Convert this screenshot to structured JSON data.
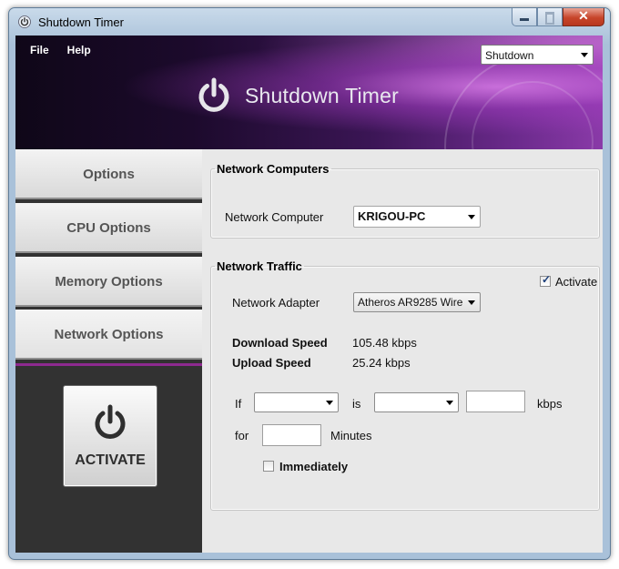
{
  "window": {
    "title": "Shutdown Timer",
    "buttons": {
      "minimize": "minimize",
      "maximize": "maximize",
      "close": "✕"
    }
  },
  "banner": {
    "menu": [
      "File",
      "Help"
    ],
    "mode_select": {
      "value": "Shutdown"
    },
    "logo_text": "Shutdown Timer"
  },
  "sidebar": {
    "items": [
      {
        "label": "Options"
      },
      {
        "label": "CPU Options"
      },
      {
        "label": "Memory Options"
      },
      {
        "label": "Network Options",
        "active": true
      }
    ],
    "activate_label": "ACTIVATE"
  },
  "network_computers": {
    "title": "Network Computers",
    "computer_label": "Network Computer",
    "computer_value": "KRIGOU-PC"
  },
  "network_traffic": {
    "title": "Network Traffic",
    "activate_label": "Activate",
    "activate_checked": true,
    "adapter_label": "Network Adapter",
    "adapter_value": "Atheros AR9285 Wire",
    "download_label": "Download Speed",
    "download_value": "105.48 kbps",
    "upload_label": "Upload Speed",
    "upload_value": "25.24 kbps",
    "if_label": "If",
    "is_label": "is",
    "kbps_label": "kbps",
    "for_label": "for",
    "minutes_label": "Minutes",
    "immediately_label": "Immediately",
    "immediately_checked": false
  },
  "colors": {
    "accent": "#8e2a90",
    "banner_dark": "#1c0a2c",
    "banner_light": "#8a3aa8",
    "sidebar_bg": "#323232"
  }
}
